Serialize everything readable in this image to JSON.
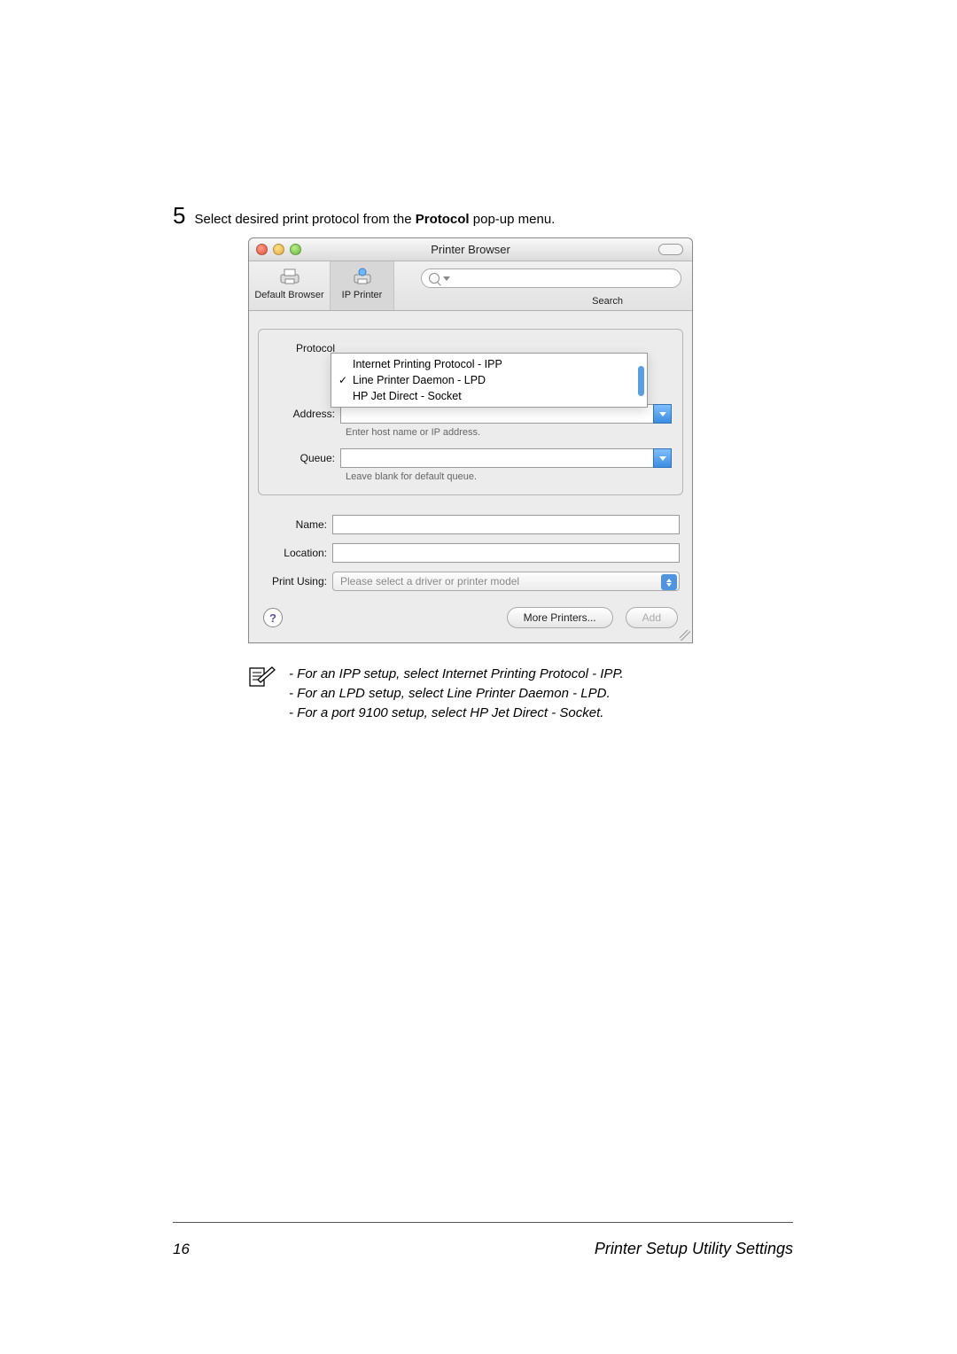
{
  "step": {
    "number": "5",
    "text_prefix": "Select desired print protocol from the ",
    "bold": "Protocol",
    "text_suffix": " pop-up menu."
  },
  "window": {
    "title": "Printer Browser",
    "toolbar": {
      "default_browser_label": "Default Browser",
      "ip_printer_label": "IP Printer",
      "search_label": "Search",
      "search_placeholder": ""
    },
    "form": {
      "protocol_label": "Protocol",
      "protocol_options": [
        "Internet Printing Protocol - IPP",
        "Line Printer Daemon - LPD",
        "HP Jet Direct - Socket"
      ],
      "protocol_selected_index": 1,
      "address_label": "Address:",
      "address_value": "",
      "address_hint": "Enter host name or IP address.",
      "queue_label": "Queue:",
      "queue_value": "",
      "queue_hint": "Leave blank for default queue.",
      "name_label": "Name:",
      "name_value": "",
      "location_label": "Location:",
      "location_value": "",
      "print_using_label": "Print Using:",
      "print_using_value": "Please select a driver or printer model"
    },
    "footer": {
      "help_glyph": "?",
      "more_printers_label": "More Printers...",
      "add_label": "Add"
    }
  },
  "note": {
    "line1": "- For an IPP setup, select Internet Printing Protocol - IPP.",
    "line2": "- For an LPD setup, select Line Printer Daemon - LPD.",
    "line3": "- For a port 9100 setup, select HP Jet Direct - Socket."
  },
  "page_footer": {
    "page_number": "16",
    "title": "Printer Setup Utility Settings"
  }
}
